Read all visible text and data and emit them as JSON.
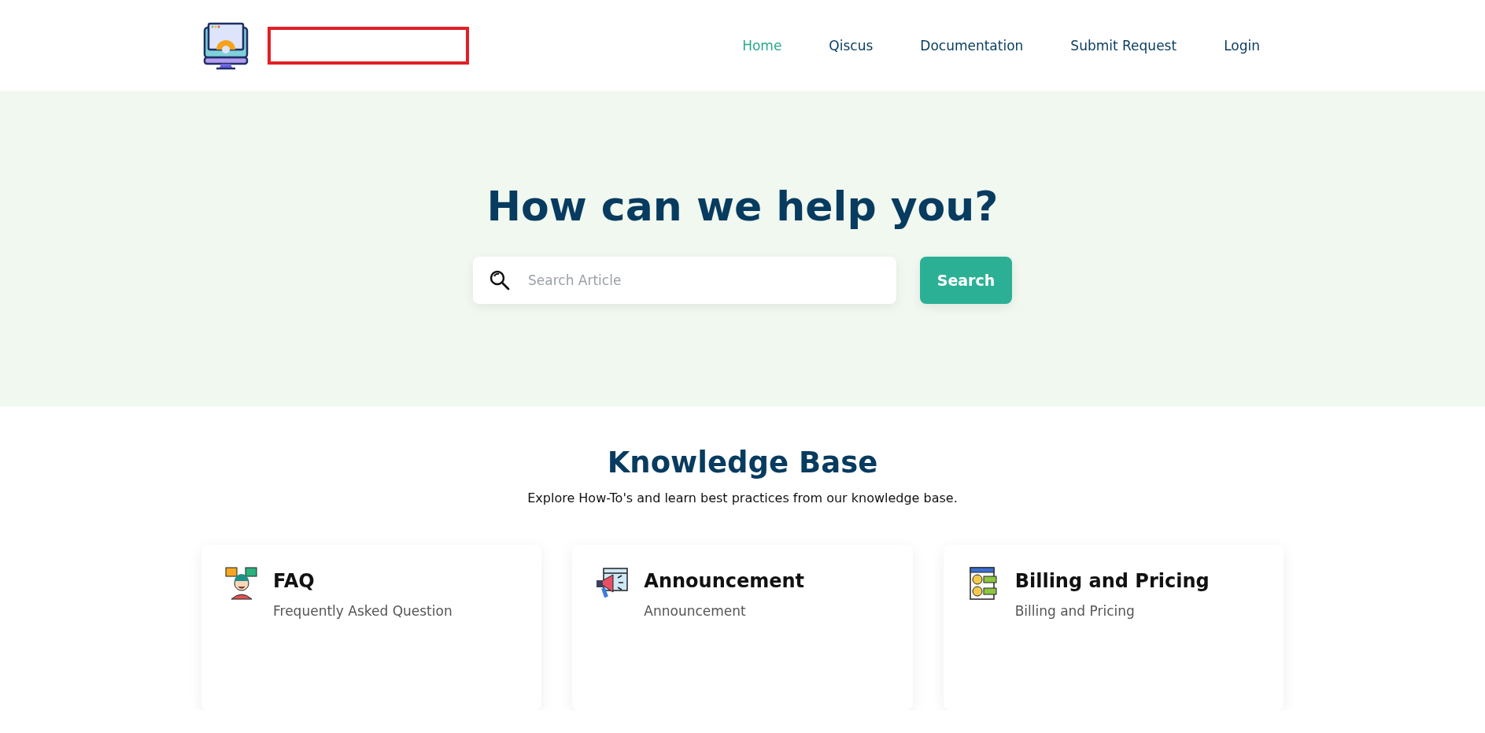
{
  "nav": [
    {
      "label": "Home",
      "selected": true
    },
    {
      "label": "Qiscus",
      "selected": false
    },
    {
      "label": "Documentation",
      "selected": false
    },
    {
      "label": "Submit Request",
      "selected": false
    },
    {
      "label": "Login",
      "selected": false
    }
  ],
  "hero": {
    "title": "How can we help you?",
    "search": {
      "placeholder": "Search Article"
    },
    "button": "Search"
  },
  "knowledge_base": {
    "title": "Knowledge Base",
    "subtitle": "Explore How-To's and learn best practices from our knowledge base.",
    "cards": [
      {
        "kind": "faq",
        "title": "FAQ",
        "description": "Frequently Asked Question"
      },
      {
        "kind": "announcement",
        "title": "Announcement",
        "description": "Announcement"
      },
      {
        "kind": "billing",
        "title": "Billing and Pricing",
        "description": "Billing and Pricing"
      }
    ]
  }
}
